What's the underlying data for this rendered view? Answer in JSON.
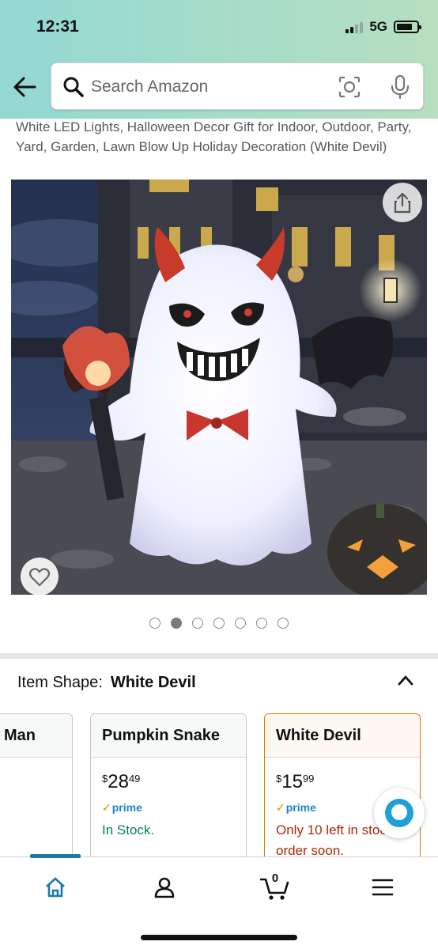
{
  "status_bar": {
    "time": "12:31",
    "network": "5G"
  },
  "search": {
    "placeholder": "Search Amazon"
  },
  "product": {
    "title": "White LED Lights, Halloween Decor Gift for Indoor, Outdoor, Party, Yard, Garden, Lawn Blow Up Holiday Decoration (White Devil)",
    "image_count": 7,
    "active_image_index": 1
  },
  "variant_selector": {
    "label": "Item Shape:",
    "selected_value": "White Devil",
    "options": [
      {
        "name": "Man"
      },
      {
        "name": "Pumpkin Snake",
        "price_symbol": "$",
        "price_whole": "28",
        "price_fraction": "49",
        "prime": "prime",
        "availability": "In Stock."
      },
      {
        "name": "White Devil",
        "price_symbol": "$",
        "price_whole": "15",
        "price_fraction": "99",
        "prime": "prime",
        "availability": "Only 10 left in stock - order soon."
      }
    ]
  },
  "bottom_nav": {
    "cart_count": "0"
  },
  "colors": {
    "header_gradient_start": "#93d8d4",
    "header_gradient_end": "#b7dfc0",
    "prime_blue": "#1e82c8",
    "in_stock_green": "#067d62",
    "low_stock_red": "#b12704",
    "selected_border": "#e77600",
    "nav_active": "#1b7aa5"
  },
  "icons": [
    "back-arrow-icon",
    "search-icon",
    "camera-scan-icon",
    "microphone-icon",
    "share-icon",
    "heart-icon",
    "chevron-up-icon",
    "alexa-icon",
    "home-icon",
    "account-icon",
    "cart-icon",
    "menu-icon"
  ]
}
